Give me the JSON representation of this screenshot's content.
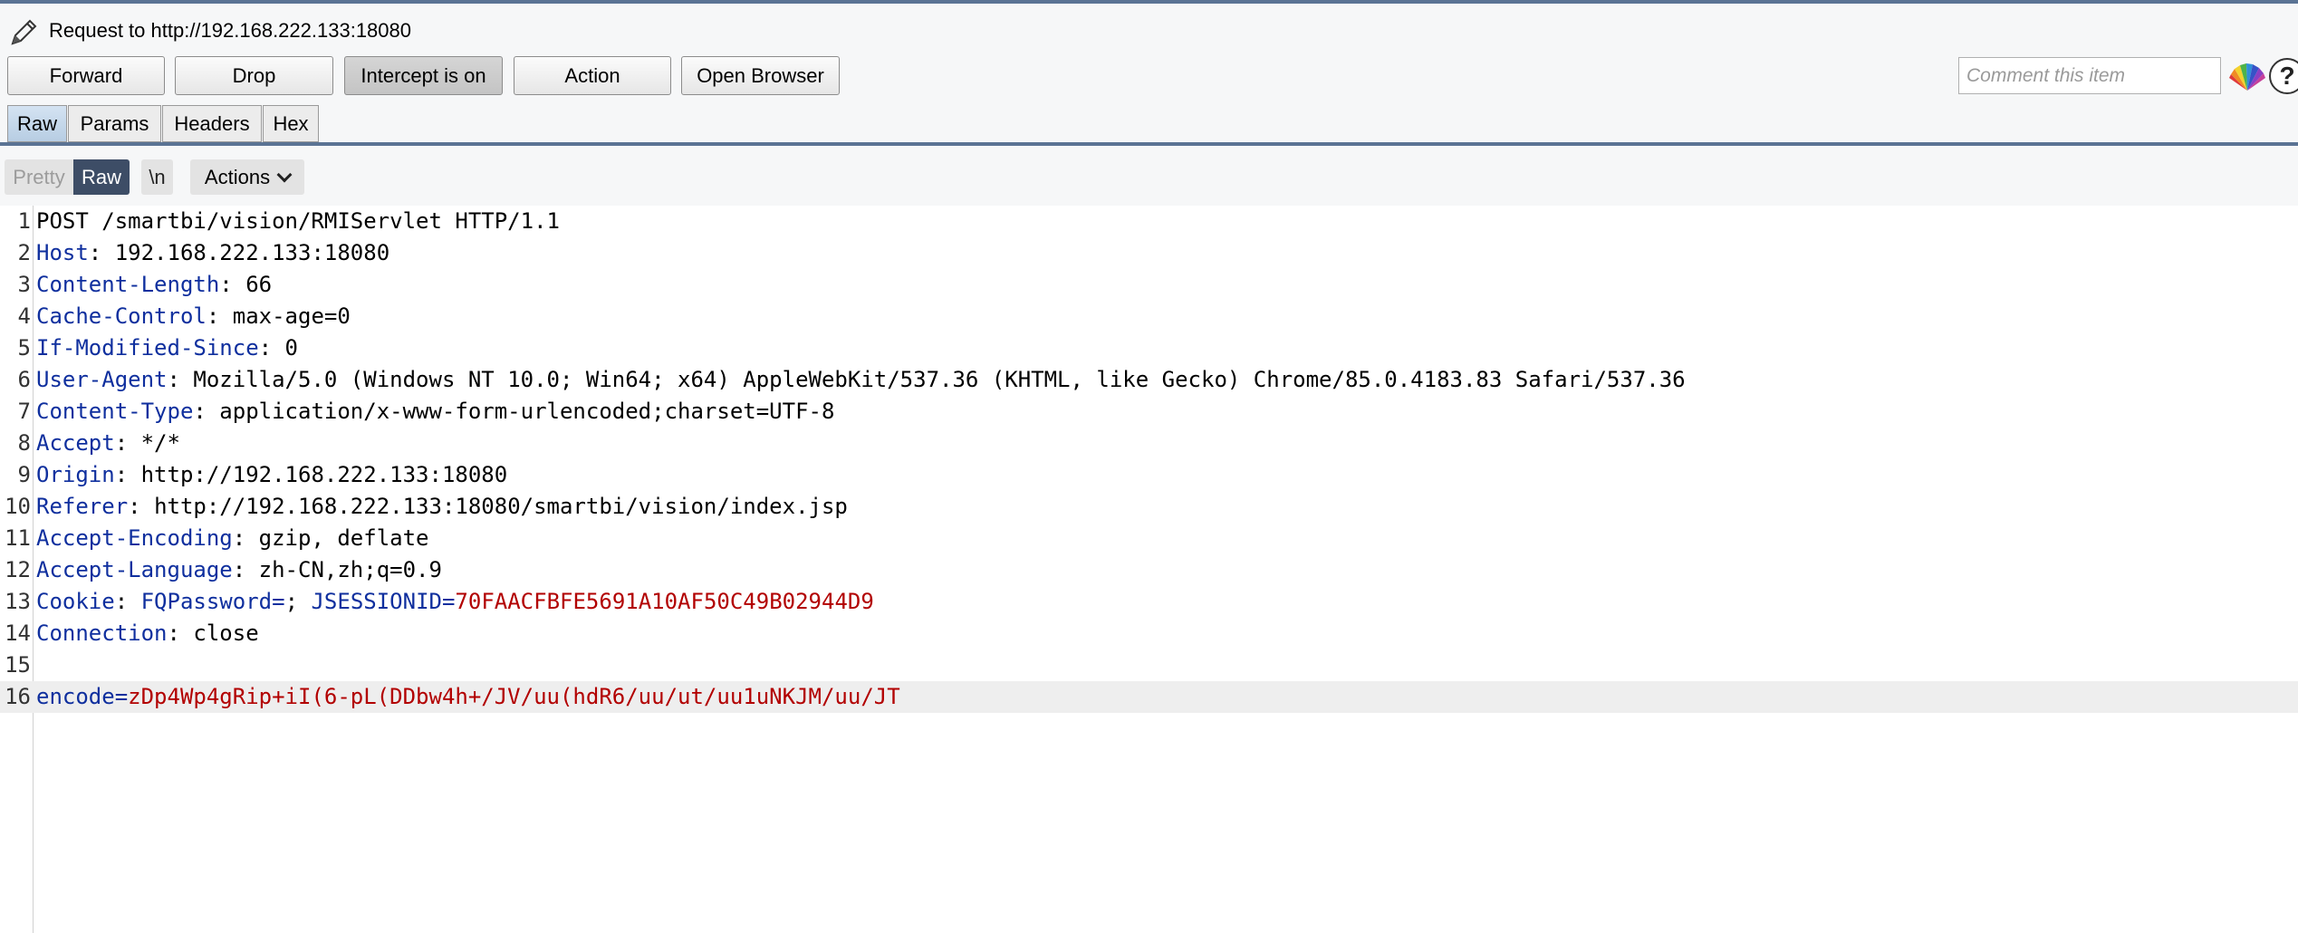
{
  "header": {
    "title": "Request to http://192.168.222.133:18080",
    "edit_icon": "pencil-icon"
  },
  "toolbar": {
    "forward_label": "Forward",
    "drop_label": "Drop",
    "intercept_label": "Intercept is on",
    "action_label": "Action",
    "open_browser_label": "Open Browser",
    "comment_placeholder": "Comment this item",
    "highlight_icon": "color-fan-icon",
    "help_label": "?"
  },
  "tabs": [
    "Raw",
    "Params",
    "Headers",
    "Hex"
  ],
  "editor_toolbar": {
    "pretty_label": "Pretty",
    "raw_label": "Raw",
    "newline_label": "\\n",
    "actions_label": "Actions"
  },
  "colors": {
    "header_key": "#0f2f9e",
    "param_value": "#b20000",
    "selected_segment": "#3d4d66",
    "accent_line": "#5a7394"
  },
  "request": {
    "lines": [
      {
        "n": "1",
        "key": "",
        "sep": "",
        "val": "POST /smartbi/vision/RMIServlet HTTP/1.1"
      },
      {
        "n": "2",
        "key": "Host",
        "sep": ": ",
        "val": "192.168.222.133:18080"
      },
      {
        "n": "3",
        "key": "Content-Length",
        "sep": ": ",
        "val": "66"
      },
      {
        "n": "4",
        "key": "Cache-Control",
        "sep": ": ",
        "val": "max-age=0"
      },
      {
        "n": "5",
        "key": "If-Modified-Since",
        "sep": ": ",
        "val": "0"
      },
      {
        "n": "6",
        "key": "User-Agent",
        "sep": ": ",
        "val": "Mozilla/5.0 (Windows NT 10.0; Win64; x64) AppleWebKit/537.36 (KHTML, like Gecko) Chrome/85.0.4183.83 Safari/537.36"
      },
      {
        "n": "7",
        "key": "Content-Type",
        "sep": ": ",
        "val": "application/x-www-form-urlencoded;charset=UTF-8"
      },
      {
        "n": "8",
        "key": "Accept",
        "sep": ": ",
        "val": "*/*"
      },
      {
        "n": "9",
        "key": "Origin",
        "sep": ": ",
        "val": "http://192.168.222.133:18080"
      },
      {
        "n": "10",
        "key": "Referer",
        "sep": ": ",
        "val": "http://192.168.222.133:18080/smartbi/vision/index.jsp"
      },
      {
        "n": "11",
        "key": "Accept-Encoding",
        "sep": ": ",
        "val": "gzip, deflate"
      },
      {
        "n": "12",
        "key": "Accept-Language",
        "sep": ": ",
        "val": "zh-CN,zh;q=0.9"
      },
      {
        "n": "13",
        "key": "Cookie",
        "sep": ": ",
        "val": "",
        "cookies": [
          {
            "name": "FQPassword",
            "value": ""
          },
          {
            "name": "JSESSIONID",
            "value": "70FAACFBFE5691A10AF50C49B02944D9"
          }
        ]
      },
      {
        "n": "14",
        "key": "Connection",
        "sep": ": ",
        "val": "close"
      },
      {
        "n": "15",
        "key": "",
        "sep": "",
        "val": ""
      },
      {
        "n": "16",
        "key": "",
        "sep": "",
        "val": "",
        "param": {
          "name": "encode",
          "value": "zDp4Wp4gRip+iI(6-pL(DDbw4h+/JV/uu(hdR6/uu/ut/uu1uNKJM/uu/JT"
        }
      }
    ]
  }
}
